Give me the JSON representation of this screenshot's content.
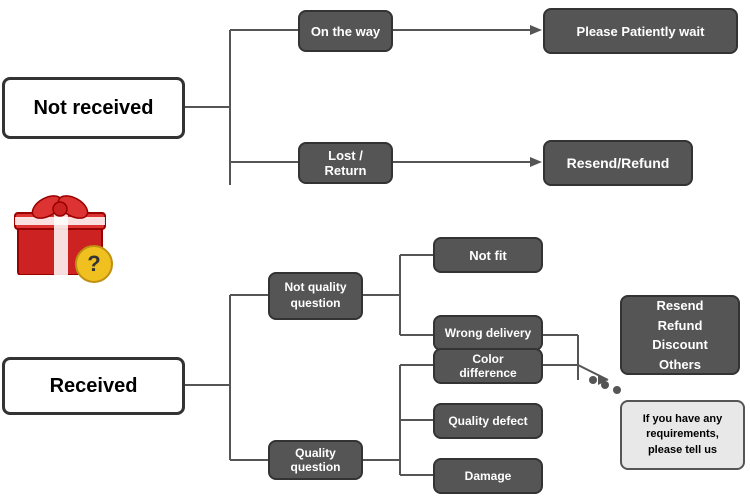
{
  "nodes": {
    "not_received": "Not received",
    "on_the_way": "On the way",
    "please_wait": "Please Patiently wait",
    "lost_return": "Lost / Return",
    "resend_refund_top": "Resend/Refund",
    "received": "Received",
    "not_quality_question": "Not quality\nquestion",
    "quality_question": "Quality question",
    "not_fit": "Not fit",
    "wrong_delivery": "Wrong delivery",
    "color_difference": "Color difference",
    "quality_defect": "Quality defect",
    "damage": "Damage",
    "resend_options": "Resend\nRefund\nDiscount\nOthers",
    "requirements": "If you have any\nrequirements,\nplease tell us"
  }
}
